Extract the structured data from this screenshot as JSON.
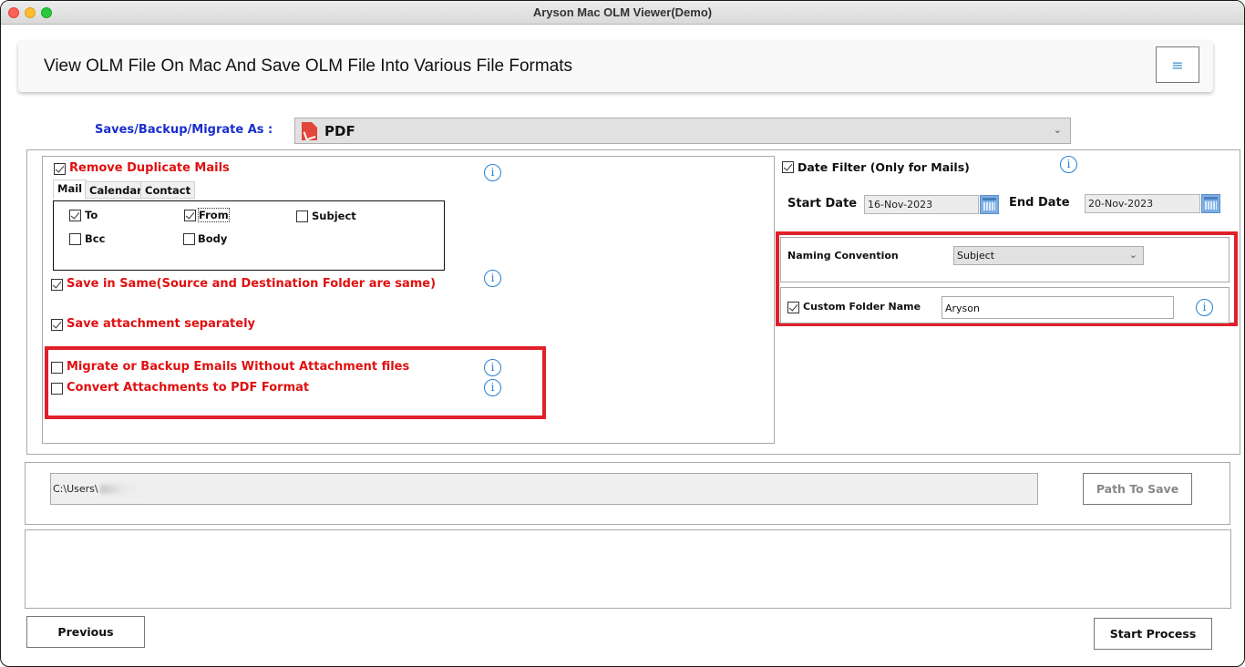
{
  "window": {
    "title": "Aryson Mac OLM Viewer(Demo)"
  },
  "header": {
    "title": "View OLM File On Mac And Save OLM File Into Various File Formats",
    "menu_icon": "≡"
  },
  "save_as": {
    "label": "Saves/Backup/Migrate As :",
    "selected": "PDF",
    "chevron": "⌄"
  },
  "left": {
    "remove_duplicates": {
      "label": "Remove Duplicate Mails",
      "checked": true
    },
    "tabs": [
      {
        "label": "Mail",
        "active": true
      },
      {
        "label": "Calendar",
        "active": false
      },
      {
        "label": "Contact",
        "active": false
      }
    ],
    "mail_fields": [
      {
        "label": "To",
        "checked": true
      },
      {
        "label": "From",
        "checked": true
      },
      {
        "label": "Subject",
        "checked": false
      },
      {
        "label": "Bcc",
        "checked": false
      },
      {
        "label": "Body",
        "checked": false
      }
    ],
    "save_in_same": {
      "label": "Save in Same(Source and Destination Folder are same)",
      "checked": true
    },
    "save_attachment": {
      "label": "Save attachment separately",
      "checked": true
    },
    "migrate_without_attachments": {
      "label": "Migrate or Backup Emails Without Attachment files",
      "checked": false
    },
    "convert_attachments_pdf": {
      "label": "Convert Attachments to PDF Format",
      "checked": false
    },
    "info_glyph": "i"
  },
  "right": {
    "date_filter": {
      "label": "Date Filter  (Only for Mails)",
      "checked": true
    },
    "start_date": {
      "label": "Start Date",
      "value": "16-Nov-2023"
    },
    "end_date": {
      "label": "End Date",
      "value": "20-Nov-2023"
    },
    "naming_convention": {
      "label": "Naming Convention",
      "selected": "Subject"
    },
    "custom_folder": {
      "label": "Custom Folder Name",
      "checked": true,
      "value": "Aryson"
    }
  },
  "path": {
    "value": "C:\\Users\\",
    "button": "Path To Save"
  },
  "footer": {
    "previous": "Previous",
    "start": "Start Process"
  },
  "colors": {
    "accent_red": "#e01010",
    "label_blue": "#1a2fcc",
    "info_blue": "#2a7fd0",
    "highlight": "#e0202a"
  }
}
